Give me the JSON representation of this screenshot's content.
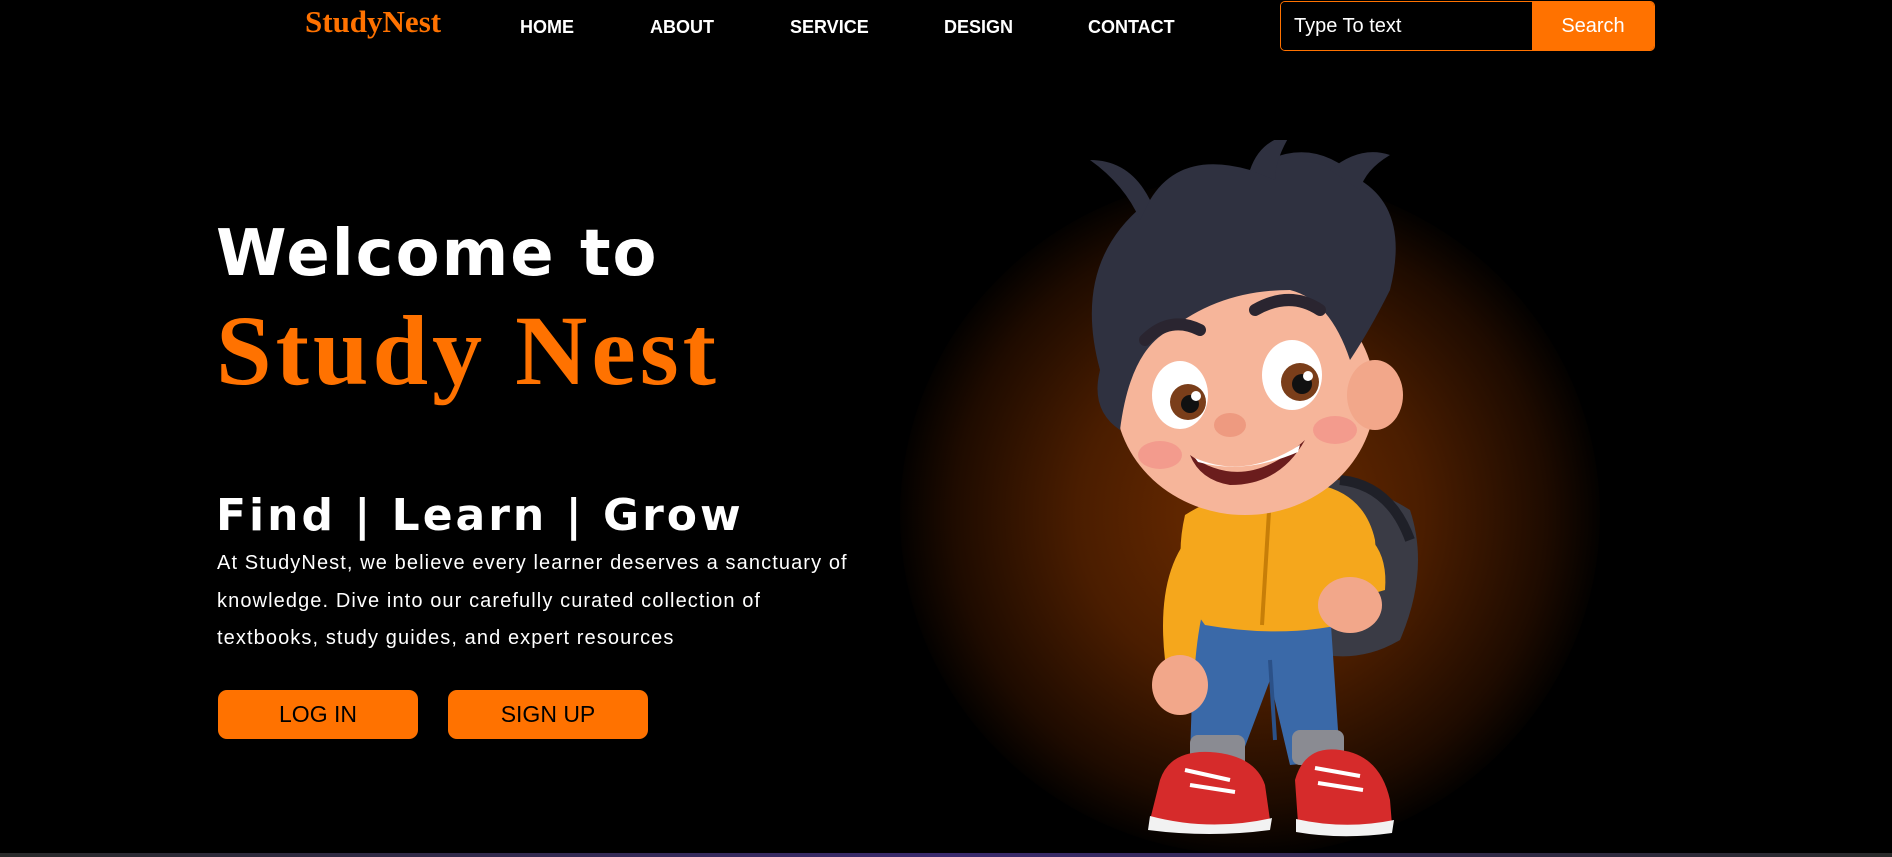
{
  "site": {
    "logo": "StudyNest",
    "accent_color": "#ff7200"
  },
  "nav": {
    "items": [
      "HOME",
      "ABOUT",
      "SERVICE",
      "DESIGN",
      "CONTACT"
    ]
  },
  "search": {
    "placeholder": "Type To text",
    "button_label": "Search"
  },
  "hero": {
    "welcome": "Welcome to",
    "brand": "Study Nest",
    "tagline": "Find | Learn | Grow",
    "description": "At StudyNest, we believe every learner deserves a sanctuary of knowledge. Dive into our carefully curated collection of textbooks, study guides, and expert resources",
    "login_label": "LOG IN",
    "signup_label": "SIGN UP"
  },
  "illustration": {
    "subject": "cartoon-boy-with-backpack-icon"
  }
}
